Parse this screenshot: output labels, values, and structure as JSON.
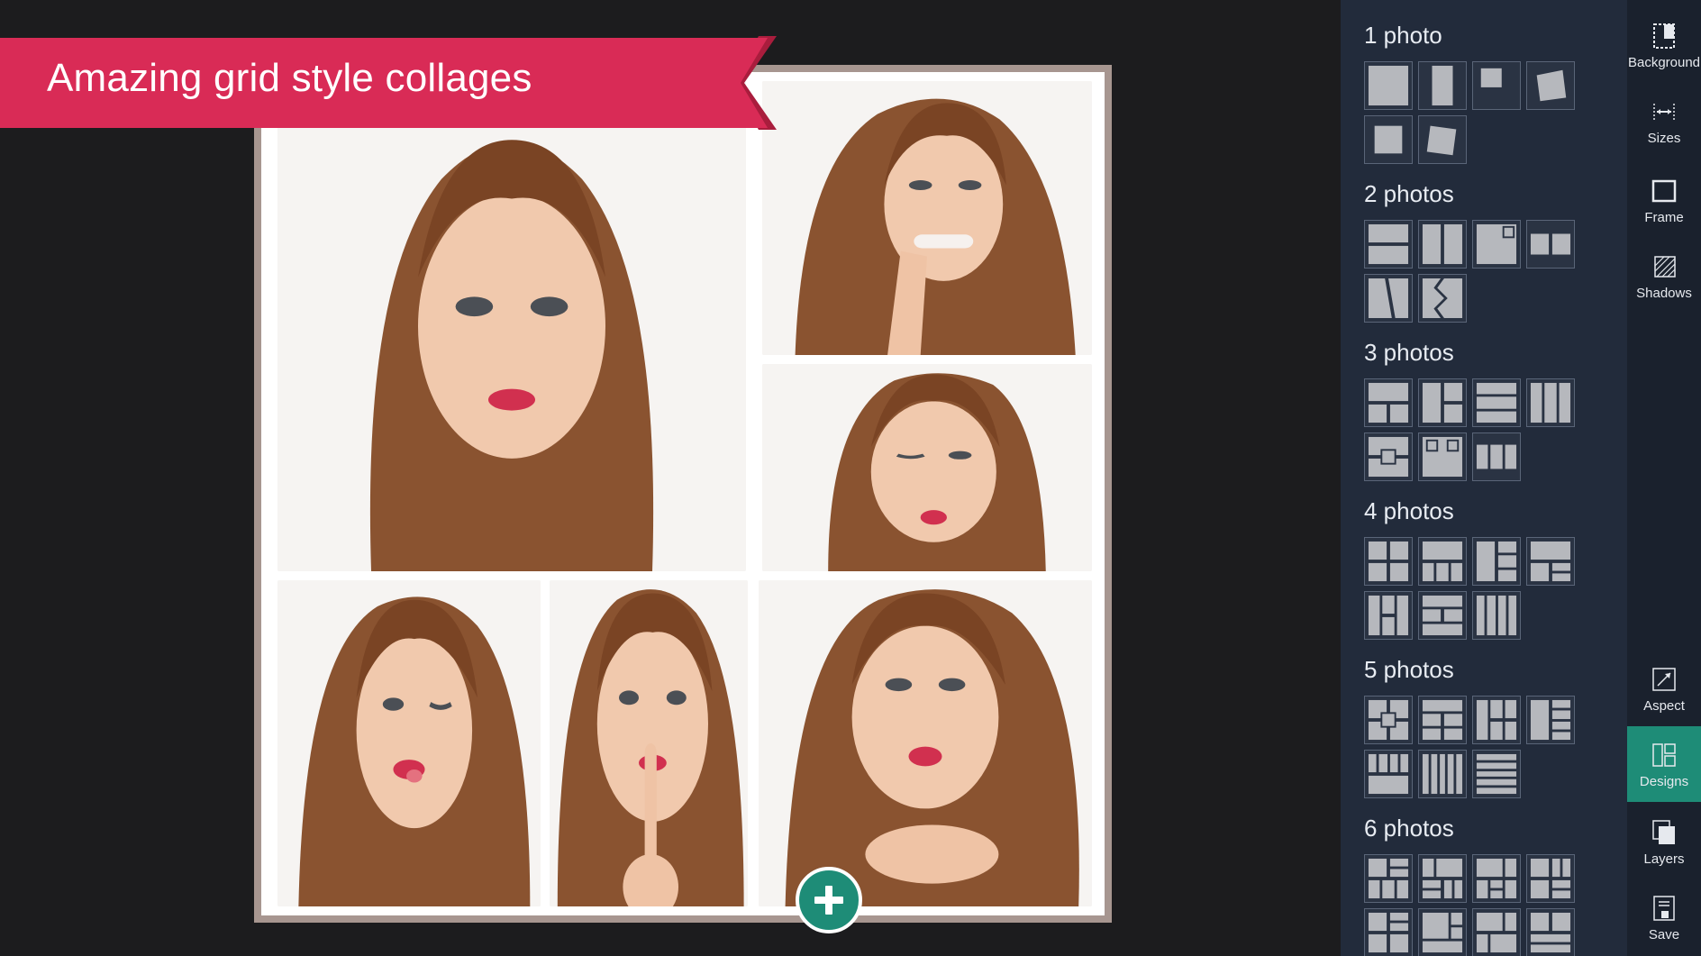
{
  "banner": {
    "text": "Amazing grid style collages"
  },
  "designs": {
    "groups": [
      {
        "title": "1 photo",
        "count": 6
      },
      {
        "title": "2 photos",
        "count": 6
      },
      {
        "title": "3 photos",
        "count": 7
      },
      {
        "title": "4 photos",
        "count": 7
      },
      {
        "title": "5 photos",
        "count": 7
      },
      {
        "title": "6 photos",
        "count": 8
      }
    ]
  },
  "toolbar": {
    "background": "Background",
    "sizes": "Sizes",
    "frame": "Frame",
    "shadows": "Shadows",
    "aspect": "Aspect",
    "designs": "Designs",
    "layers": "Layers",
    "save": "Save"
  },
  "colors": {
    "accent": "#1e8c77",
    "banner": "#d92b56",
    "frame": "#a79690",
    "panel": "#222b3b",
    "toolbar": "#1a212d"
  }
}
